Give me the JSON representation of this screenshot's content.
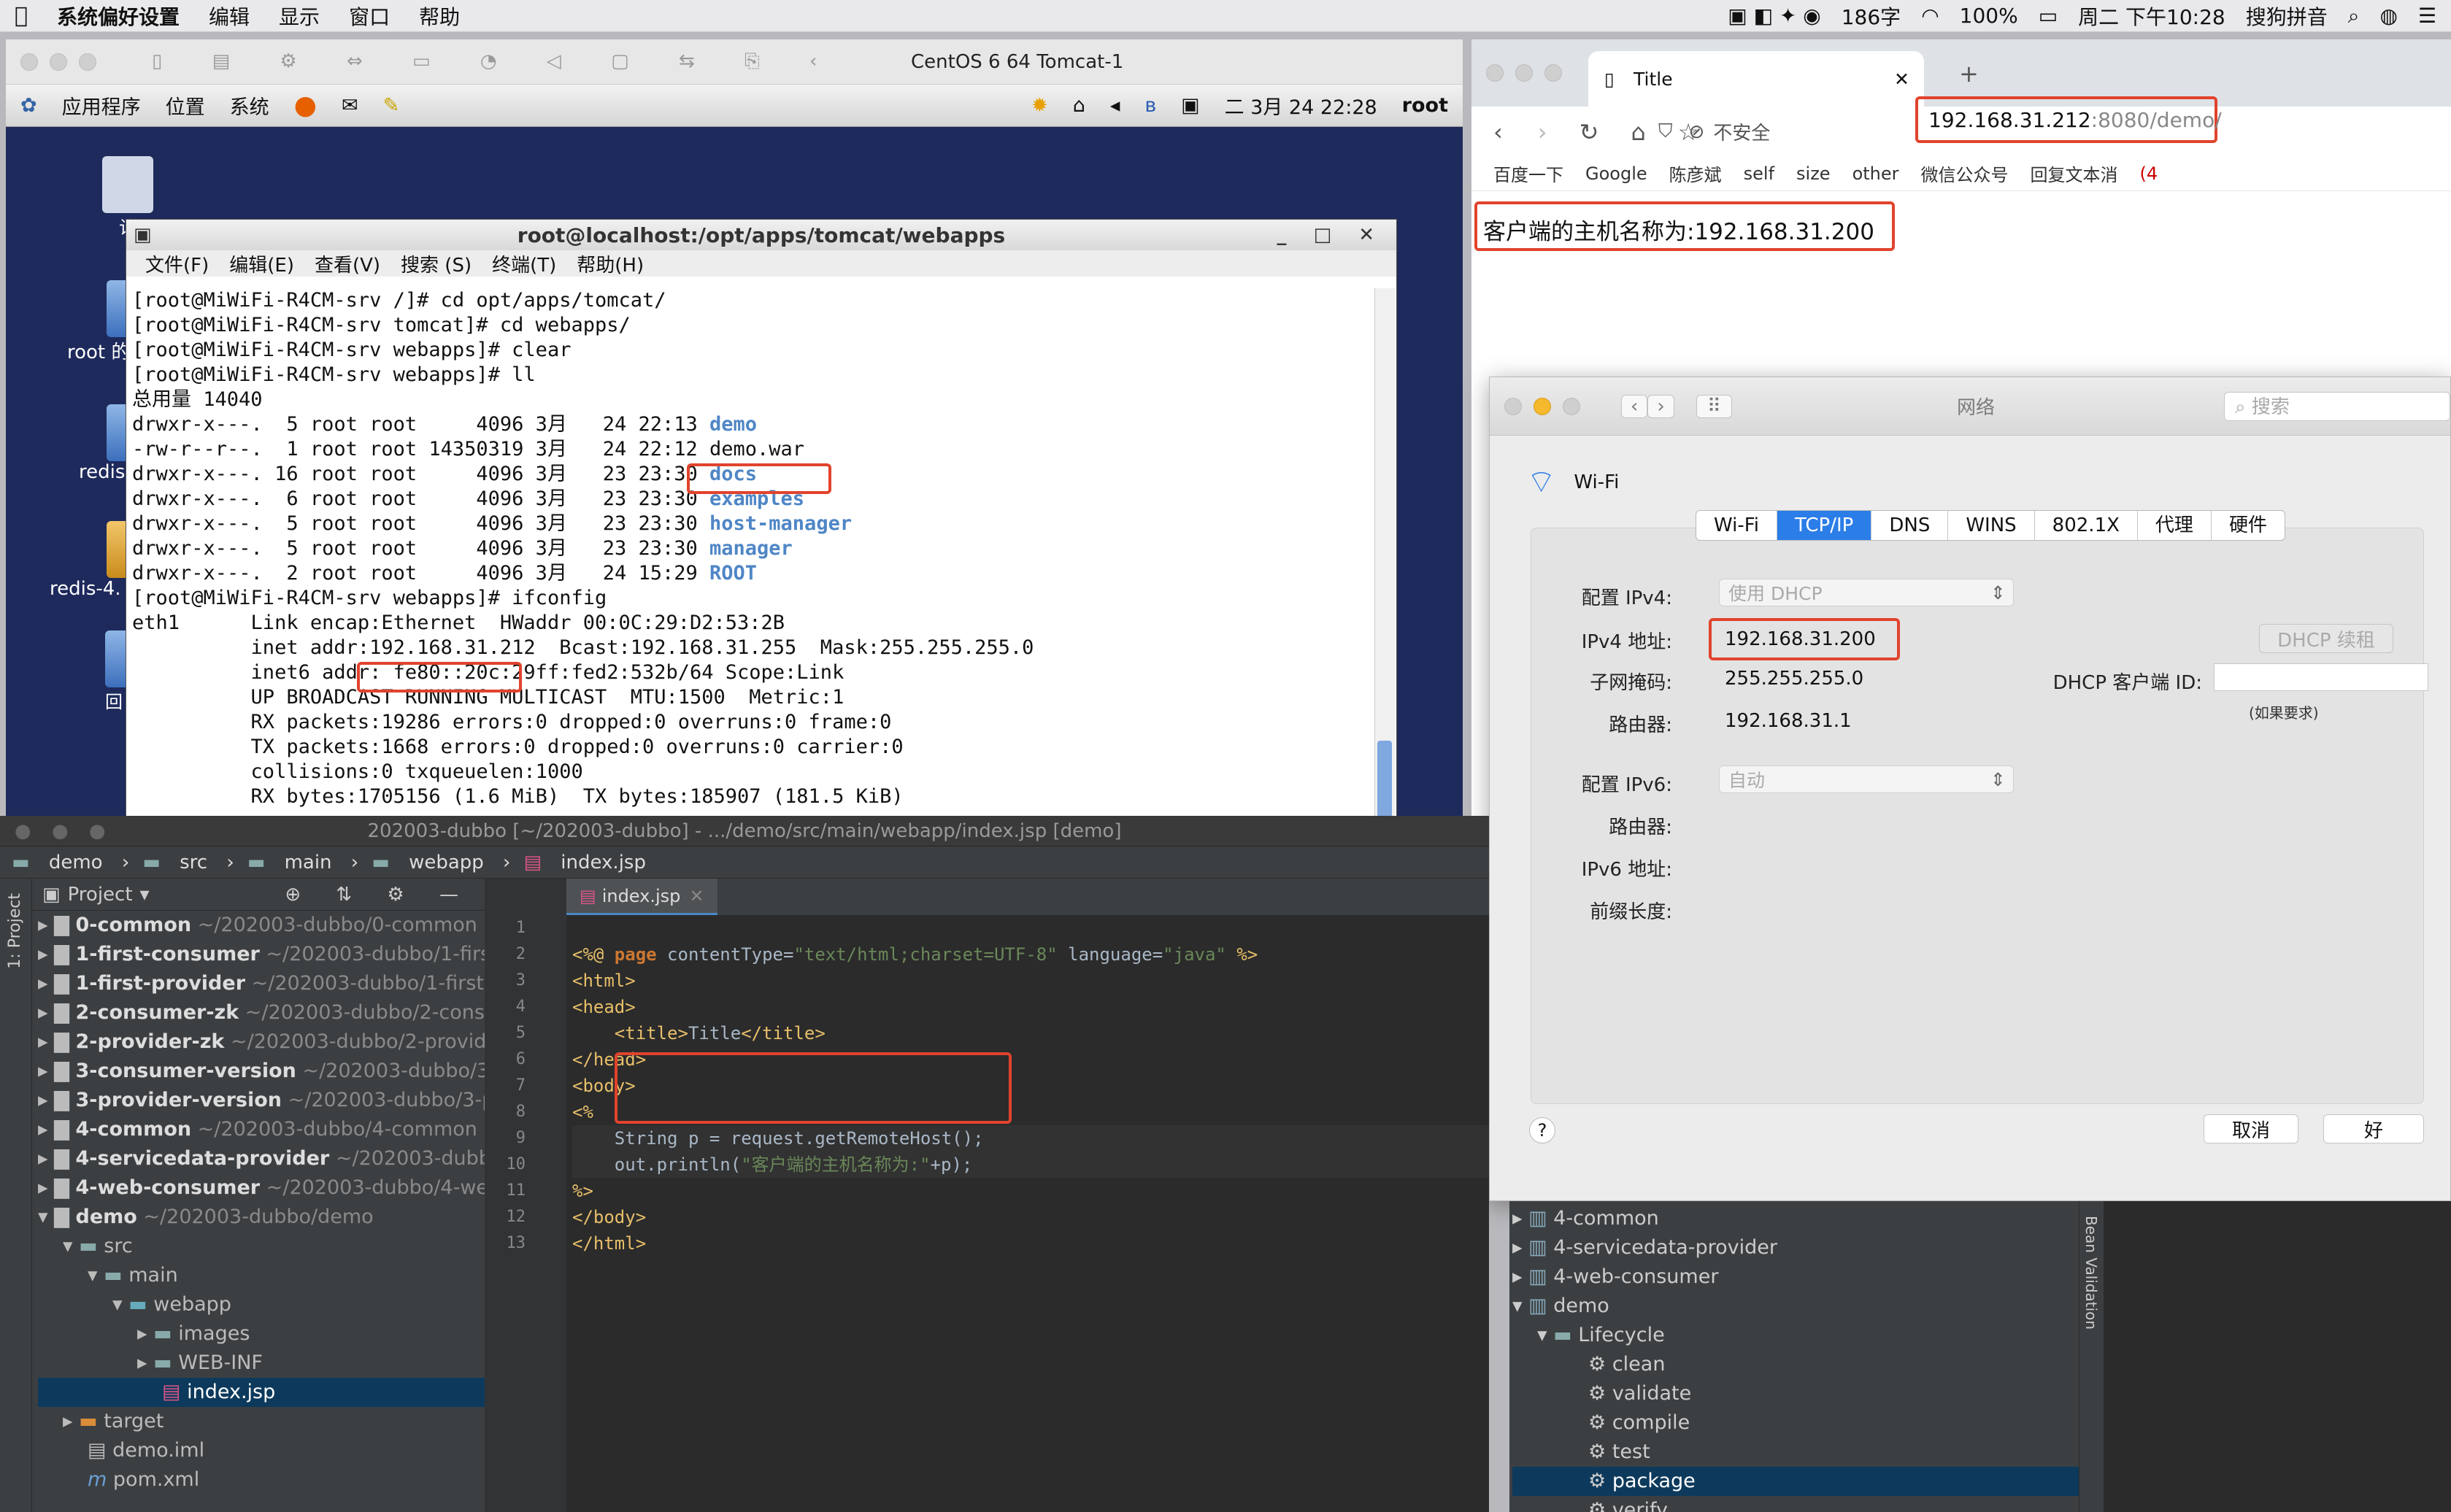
{
  "menubar": {
    "apple": "",
    "app": "系统偏好设置",
    "items": [
      "编辑",
      "显示",
      "窗口",
      "帮助"
    ],
    "status": [
      "186字",
      "100%",
      "周二 下午10:28",
      "搜狗拼音"
    ]
  },
  "vm": {
    "title": "CentOS 6 64 Tomcat-1",
    "gnome_menu": [
      "应用程序",
      "位置",
      "系统"
    ],
    "clock": "二 3月 24 22:28",
    "user": "root",
    "desktop": [
      "计",
      "root 的",
      "redis",
      "redis-4.",
      "回"
    ],
    "terminal": {
      "title": "root@localhost:/opt/apps/tomcat/webapps",
      "menu": [
        "文件(F)",
        "编辑(E)",
        "查看(V)",
        "搜索 (S)",
        "终端(T)",
        "帮助(H)"
      ],
      "lines": [
        "[root@MiWiFi-R4CM-srv /]# cd opt/apps/tomcat/",
        "[root@MiWiFi-R4CM-srv tomcat]# cd webapps/",
        "[root@MiWiFi-R4CM-srv webapps]# clear",
        "",
        "[root@MiWiFi-R4CM-srv webapps]# ll",
        "总用量 14040"
      ],
      "listing": [
        {
          "perm": "drwxr-x---.  5 root root     4096 3月   24 22:13 ",
          "name": "demo",
          "blue": true
        },
        {
          "perm": "-rw-r--r--.  1 root root 14350319 3月   24 22:12 ",
          "name": "demo.war",
          "blue": false
        },
        {
          "perm": "drwxr-x---. 16 root root     4096 3月   23 23:30 ",
          "name": "docs",
          "blue": true
        },
        {
          "perm": "drwxr-x---.  6 root root     4096 3月   23 23:30 ",
          "name": "examples",
          "blue": true
        },
        {
          "perm": "drwxr-x---.  5 root root     4096 3月   23 23:30 ",
          "name": "host-manager",
          "blue": true
        },
        {
          "perm": "drwxr-x---.  5 root root     4096 3月   23 23:30 ",
          "name": "manager",
          "blue": true
        },
        {
          "perm": "drwxr-x---.  2 root root     4096 3月   24 15:29 ",
          "name": "ROOT",
          "blue": true
        }
      ],
      "after": [
        "[root@MiWiFi-R4CM-srv webapps]# ifconfig",
        "eth1      Link encap:Ethernet  HWaddr 00:0C:29:D2:53:2B",
        "          inet addr:192.168.31.212  Bcast:192.168.31.255  Mask:255.255.255.0",
        "          inet6 addr: fe80::20c:29ff:fed2:532b/64 Scope:Link",
        "          UP BROADCAST RUNNING MULTICAST  MTU:1500  Metric:1",
        "          RX packets:19286 errors:0 dropped:0 overruns:0 frame:0",
        "          TX packets:1668 errors:0 dropped:0 overruns:0 carrier:0",
        "          collisions:0 txqueuelen:1000",
        "          RX bytes:1705156 (1.6 MiB)  TX bytes:185907 (181.5 KiB)"
      ]
    }
  },
  "chrome": {
    "tab_title": "Title",
    "url_host": "192.168.31.212",
    "url_rest": ":8080/demo/",
    "insecure": "不安全",
    "bookmarks": [
      "百度一下",
      "Google",
      "陈彦斌",
      "self",
      "size",
      "other",
      "微信公众号",
      "回复文本消",
      "(4"
    ],
    "page_text": "客户端的主机名称为:192.168.31.200"
  },
  "network": {
    "title": "网络",
    "search_placeholder": "搜索",
    "iface": "Wi-Fi",
    "tabs": [
      "Wi-Fi",
      "TCP/IP",
      "DNS",
      "WINS",
      "802.1X",
      "代理",
      "硬件"
    ],
    "active_tab": "TCP/IP",
    "config_ipv4_label": "配置 IPv4:",
    "config_ipv4": "使用 DHCP",
    "ipv4_label": "IPv4 地址:",
    "ipv4": "192.168.31.200",
    "renew": "DHCP 续租",
    "mask_label": "子网掩码:",
    "mask": "255.255.255.0",
    "client_id_label": "DHCP 客户端 ID:",
    "client_id_hint": "(如果要求)",
    "router_label": "路由器:",
    "router": "192.168.31.1",
    "config_ipv6_label": "配置 IPv6:",
    "config_ipv6": "自动",
    "router6_label": "路由器:",
    "ipv6_label": "IPv6 地址:",
    "prefix_label": "前缀长度:",
    "help": "?",
    "cancel": "取消",
    "ok": "好"
  },
  "ide": {
    "title": "202003-dubbo [~/202003-dubbo] - .../demo/src/main/webapp/index.jsp [demo]",
    "breadcrumb": [
      "demo",
      "src",
      "main",
      "webapp",
      "index.jsp"
    ],
    "project_label": "Project",
    "side_tab": "1: Project",
    "editor_tab": "index.jsp",
    "tree": [
      {
        "name": "0-common",
        "path": "~/202003-dubbo/0-common"
      },
      {
        "name": "1-first-consumer",
        "path": "~/202003-dubbo/1-first"
      },
      {
        "name": "1-first-provider",
        "path": "~/202003-dubbo/1-first-"
      },
      {
        "name": "2-consumer-zk",
        "path": "~/202003-dubbo/2-cons"
      },
      {
        "name": "2-provider-zk",
        "path": "~/202003-dubbo/2-provid"
      },
      {
        "name": "3-consumer-version",
        "path": "~/202003-dubbo/3-"
      },
      {
        "name": "3-provider-version",
        "path": "~/202003-dubbo/3-p"
      },
      {
        "name": "4-common",
        "path": "~/202003-dubbo/4-common"
      },
      {
        "name": "4-servicedata-provider",
        "path": "~/202003-dubbo"
      },
      {
        "name": "4-web-consumer",
        "path": "~/202003-dubbo/4-we"
      },
      {
        "name": "demo",
        "path": "~/202003-dubbo/demo"
      }
    ],
    "subtree": [
      "src",
      "main",
      "webapp",
      "images",
      "WEB-INF",
      "index.jsp",
      "target",
      "demo.iml",
      "pom.xml"
    ],
    "code": {
      "line1a": "<%@ ",
      "line1b": "page ",
      "line1c": "contentType=",
      "line1d": "\"text/html;charset=UTF-8\"",
      "line1e": " language=",
      "line1f": "\"java\"",
      "line1g": " %>",
      "l2": "<html>",
      "l3": "<head>",
      "l4a": "<title>",
      "l4b": "Title",
      "l4c": "</title>",
      "l5": "</head>",
      "l6": "<body>",
      "l7": "<%",
      "l8": "String p = request.getRemoteHost();",
      "l9a": "out.println(",
      "l9b": "\"客户端的主机名称为:\"",
      "l9c": "+p);",
      "l10": "%>",
      "l11": "</body>",
      "l12": "</html>"
    },
    "lines": [
      "1",
      "2",
      "3",
      "4",
      "5",
      "6",
      "7",
      "8",
      "9",
      "10",
      "11",
      "12",
      "13"
    ],
    "maven": [
      "4-common",
      "4-servicedata-provider",
      "4-web-consumer",
      "demo",
      "Lifecycle",
      "clean",
      "validate",
      "compile",
      "test",
      "package",
      "verify"
    ],
    "bean_validation": "Bean Validation"
  }
}
